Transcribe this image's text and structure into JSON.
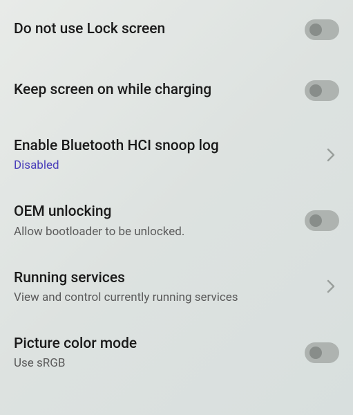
{
  "settings": {
    "lock_screen": {
      "title": "Do not use Lock screen"
    },
    "keep_screen": {
      "title": "Keep screen on while charging"
    },
    "bluetooth_hci": {
      "title": "Enable Bluetooth HCI snoop log",
      "subtitle": "Disabled"
    },
    "oem_unlocking": {
      "title": "OEM unlocking",
      "subtitle": "Allow bootloader to be unlocked."
    },
    "running_services": {
      "title": "Running services",
      "subtitle": "View and control currently running services"
    },
    "picture_color": {
      "title": "Picture color mode",
      "subtitle": "Use sRGB"
    }
  }
}
